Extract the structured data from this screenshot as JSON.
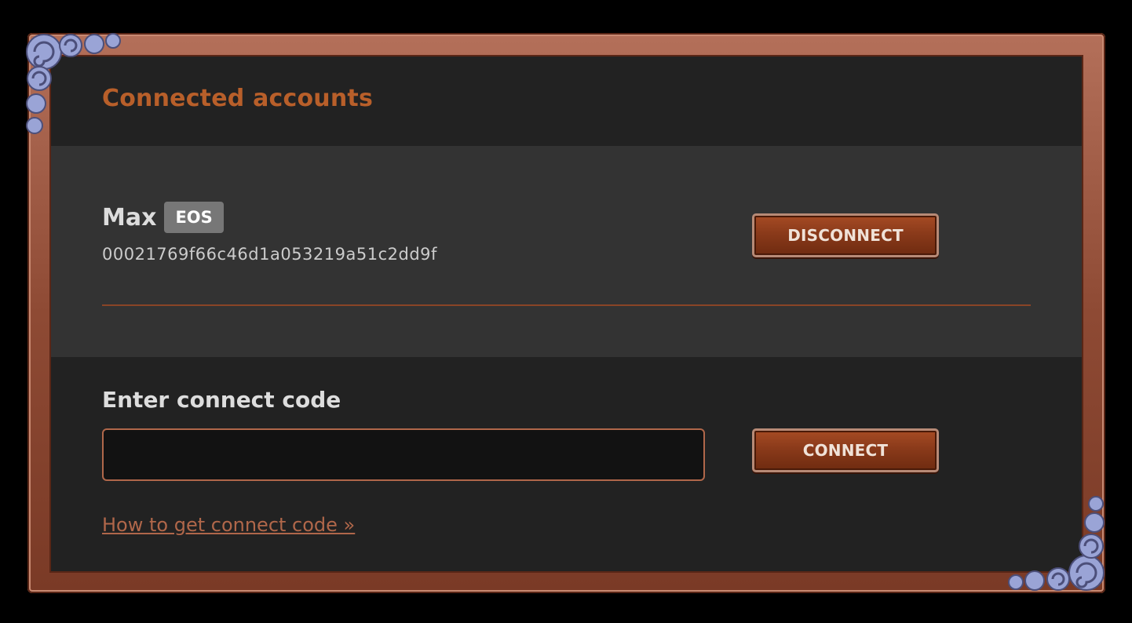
{
  "panel": {
    "title": "Connected accounts"
  },
  "account": {
    "name": "Max",
    "chain": "EOS",
    "id": "00021769f66c46d1a053219a51c2dd9f",
    "disconnect_label": "DISCONNECT"
  },
  "connect": {
    "label": "Enter connect code",
    "input_value": "",
    "button_label": "CONNECT",
    "help_link": "How to get connect code »"
  },
  "colors": {
    "accent": "#b85f2a",
    "background": "#222222",
    "section_bg": "#333333",
    "frame": "#8e4a34",
    "ornament": "#9aa4d6"
  },
  "icons": {
    "top_left": "scroll-ornament-icon",
    "bottom_right": "scroll-ornament-icon"
  }
}
